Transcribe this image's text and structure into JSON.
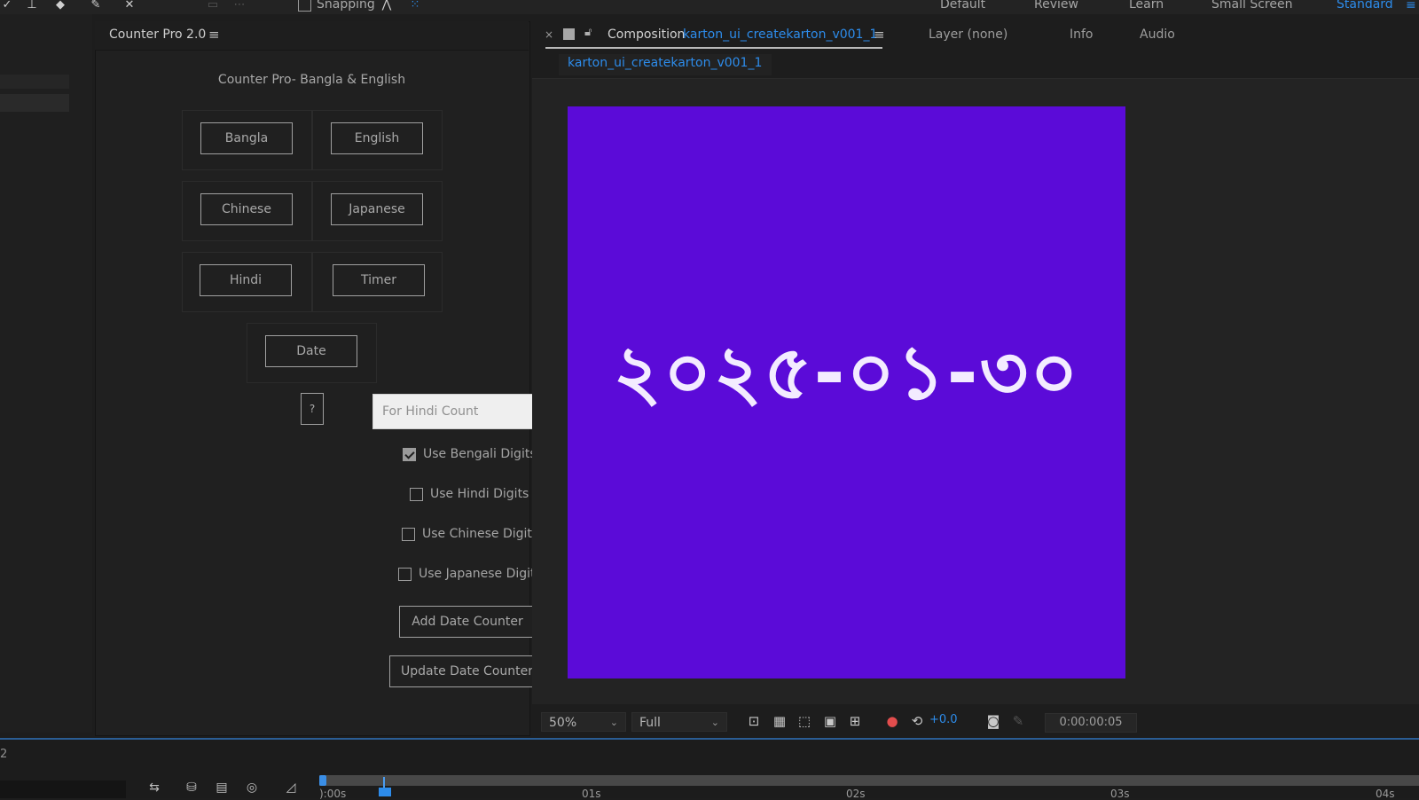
{
  "toolbar": {
    "snapping_label": "Snapping",
    "workspaces": [
      {
        "label": "Default",
        "active": false
      },
      {
        "label": "Review",
        "active": false
      },
      {
        "label": "Learn",
        "active": false
      },
      {
        "label": "Small Screen",
        "active": false
      },
      {
        "label": "Standard",
        "active": true
      }
    ]
  },
  "counter_panel": {
    "title": "Counter Pro 2.0",
    "subtitle": "Counter Pro- Bangla & English",
    "buttons": {
      "bangla": "Bangla",
      "english": "English",
      "chinese": "Chinese",
      "japanese": "Japanese",
      "hindi": "Hindi",
      "timer": "Timer",
      "date": "Date",
      "help": "?"
    },
    "hindi_field_placeholder": "For Hindi Count",
    "checkboxes": [
      {
        "label": "Use Bengali Digits",
        "checked": true
      },
      {
        "label": "Use Hindi Digits",
        "checked": false
      },
      {
        "label": "Use Chinese Digits",
        "checked": false
      },
      {
        "label": "Use Japanese Digits",
        "checked": false
      }
    ],
    "add_date_counter": "Add Date Counter",
    "update_date_counter": "Update Date Counter"
  },
  "composition": {
    "panel_label": "Composition",
    "comp_name": "karton_ui_createkarton_v001_1",
    "sub_tab": "karton_ui_createkarton_v001_1",
    "other_tabs": [
      "Layer (none)",
      "Info",
      "Audio"
    ],
    "canvas_text": "২০২৫-০১-৩০",
    "canvas_color": "#5b0bd8",
    "accent_color": "#2d8ceb"
  },
  "viewer_footer": {
    "zoom": "50%",
    "resolution": "Full",
    "exposure": "+0.0",
    "timecode": "0:00:00:05"
  },
  "timeline": {
    "layer_number": "2",
    "ticks": [
      "):00s",
      "01s",
      "02s",
      "03s",
      "04s"
    ]
  }
}
